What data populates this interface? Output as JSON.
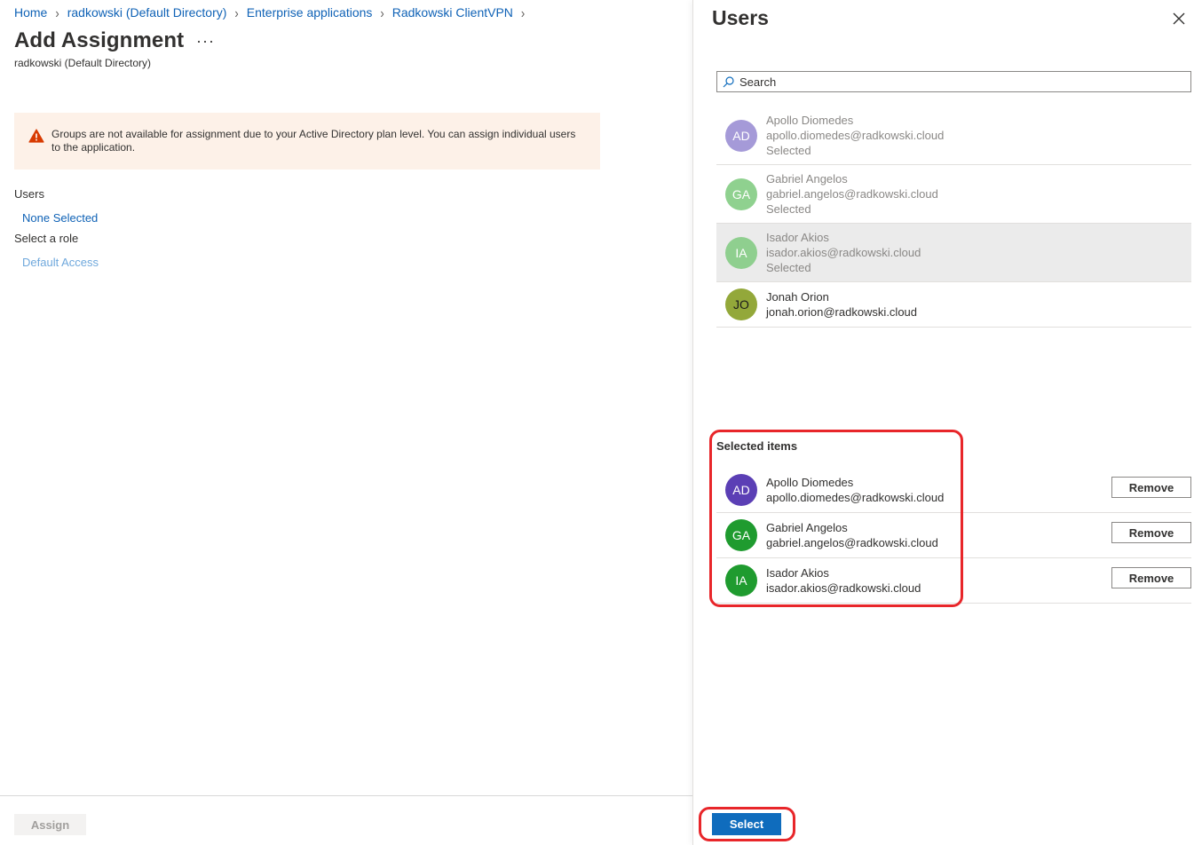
{
  "breadcrumb": {
    "items": [
      "Home",
      "radkowski (Default Directory)",
      "Enterprise applications",
      "Radkowski ClientVPN"
    ]
  },
  "page": {
    "title": "Add Assignment",
    "more_label": "···",
    "subtitle": "radkowski (Default Directory)"
  },
  "warning": {
    "icon": "warning-triangle-icon",
    "color": "#d83b01",
    "text": "Groups are not available for assignment due to your Active Directory plan level. You can assign individual users to the application."
  },
  "form": {
    "users_label": "Users",
    "users_value": "None Selected",
    "role_label": "Select a role",
    "role_value": "Default Access"
  },
  "footer": {
    "assign_label": "Assign",
    "select_label": "Select"
  },
  "blade": {
    "title": "Users",
    "search_placeholder": "Search",
    "users": [
      {
        "initials": "AD",
        "name": "Apollo Diomedes",
        "email": "apollo.diomedes@radkowski.cloud",
        "status": "Selected",
        "color": "#a59ad8"
      },
      {
        "initials": "GA",
        "name": "Gabriel Angelos",
        "email": "gabriel.angelos@radkowski.cloud",
        "status": "Selected",
        "color": "#8fd18f"
      },
      {
        "initials": "IA",
        "name": "Isador Akios",
        "email": "isador.akios@radkowski.cloud",
        "status": "Selected",
        "color": "#8fcf8f"
      },
      {
        "initials": "JO",
        "name": "Jonah Orion",
        "email": "jonah.orion@radkowski.cloud",
        "status": "",
        "color": "#93a83a"
      }
    ],
    "selected_heading": "Selected items",
    "selected": [
      {
        "initials": "AD",
        "name": "Apollo Diomedes",
        "email": "apollo.diomedes@radkowski.cloud",
        "color": "#5b3fb5",
        "remove_label": "Remove"
      },
      {
        "initials": "GA",
        "name": "Gabriel Angelos",
        "email": "gabriel.angelos@radkowski.cloud",
        "color": "#1f9b2f",
        "remove_label": "Remove"
      },
      {
        "initials": "IA",
        "name": "Isador Akios",
        "email": "isador.akios@radkowski.cloud",
        "color": "#1f9b2f",
        "remove_label": "Remove"
      }
    ]
  },
  "colors": {
    "accent": "#0f6cbd",
    "link": "#0f62b6",
    "highlight_annotation": "#e8262a"
  }
}
